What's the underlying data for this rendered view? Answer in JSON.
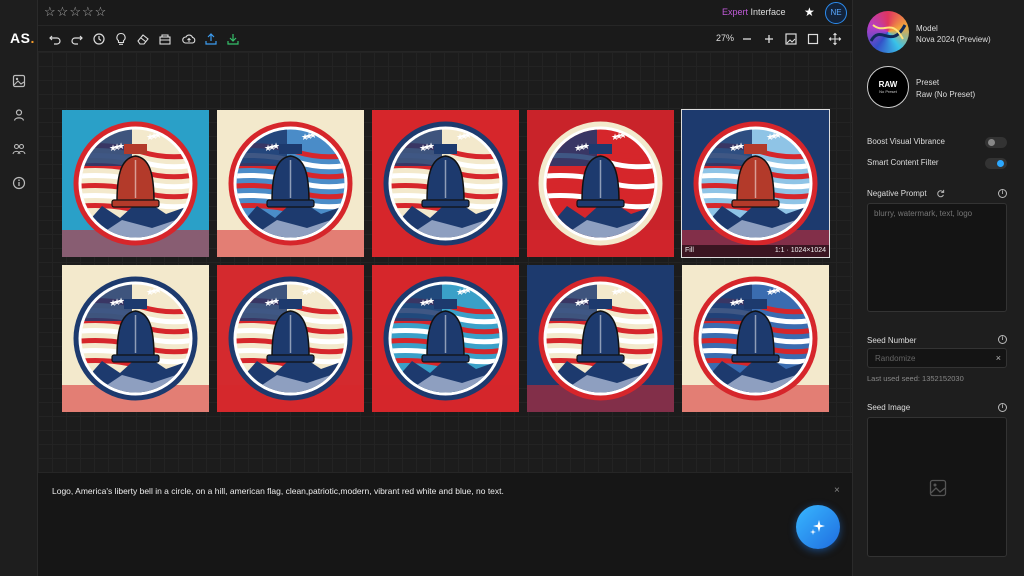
{
  "app": {
    "logo": "AS",
    "logo_dot": "."
  },
  "topbar": {
    "rating_stars": [
      "☆",
      "☆",
      "☆",
      "☆",
      "☆"
    ],
    "expert_label_1": "Expert",
    "expert_label_2": "Interface",
    "avatar_initials": "NE"
  },
  "toolbar": {
    "zoom": "27%"
  },
  "canvas": {
    "tiles": [
      {
        "scheme": "a"
      },
      {
        "scheme": "b"
      },
      {
        "scheme": "c"
      },
      {
        "scheme": "d"
      },
      {
        "scheme": "e"
      },
      {
        "scheme": "f"
      },
      {
        "scheme": "g"
      },
      {
        "scheme": "h"
      },
      {
        "scheme": "i"
      },
      {
        "scheme": "j"
      }
    ],
    "selected_overlay": {
      "left": "Fill",
      "right": "1:1 · 1024×1024"
    }
  },
  "prompt": {
    "text": "Logo, America's liberty bell in a circle, on a hill, american flag, clean,patriotic,modern, vibrant red white and blue, no text.",
    "clear": "×"
  },
  "panel": {
    "model_label": "Model",
    "model_value": "Nova 2024 (Preview)",
    "preset_label": "Preset",
    "preset_value": "Raw (No Preset)",
    "preset_badge": "RAW",
    "preset_badge_sub": "No Preset",
    "boost_label": "Boost Visual Vibrance",
    "boost_on": false,
    "smart_label": "Smart Content Filter",
    "smart_on": true,
    "negative_label": "Negative Prompt",
    "negative_placeholder": "blurry, watermark, text, logo",
    "seed_label": "Seed Number",
    "seed_placeholder": "Randomize",
    "seed_clear": "×",
    "last_seed": "Last used seed: 1352152030",
    "seed_image_label": "Seed Image",
    "info_glyph": "i"
  },
  "colors": {
    "accent": "#2ca8ff",
    "expert": "#c05ad8",
    "flag_red": "#d6262b",
    "flag_blue": "#1d3a6e",
    "cream": "#f3e9cc"
  }
}
